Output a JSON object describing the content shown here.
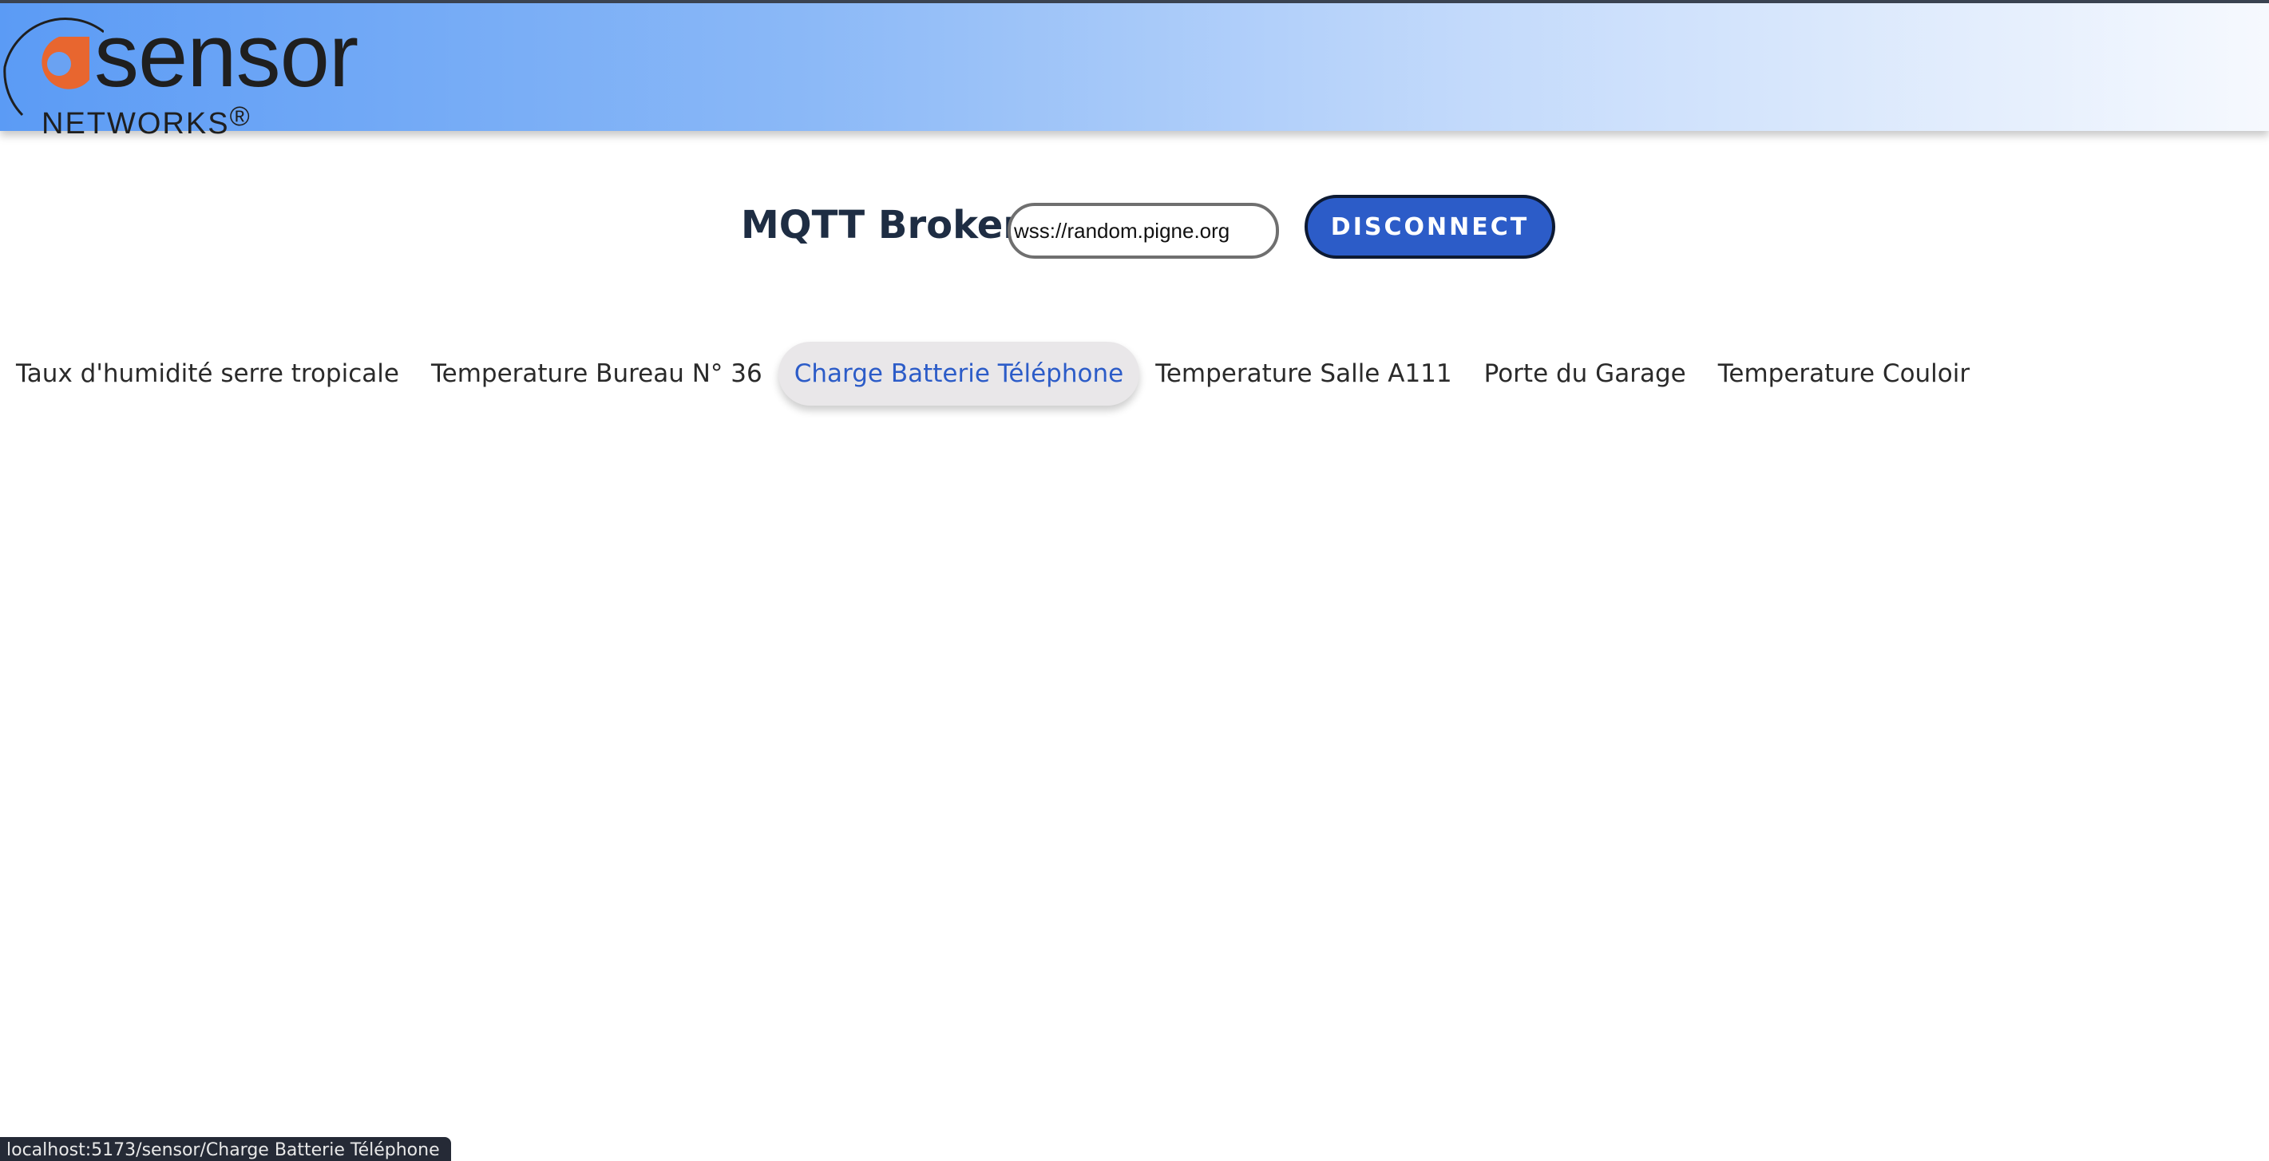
{
  "brand": {
    "wordmark": "sensor",
    "subtitle": "NETWORKS",
    "registered_mark": "®",
    "accent_color": "#e8662f",
    "header_gradient": [
      "#5b9bf5",
      "#f6f9fe"
    ]
  },
  "broker": {
    "label": "MQTT Broker:",
    "url_value": "wss://random.pigne.org",
    "disconnect_label": "DISCONNECT",
    "button_color": "#2c5cc8"
  },
  "tabs": [
    {
      "label": "Taux d'humidité serre tropicale",
      "active": false
    },
    {
      "label": "Temperature Bureau N° 36",
      "active": false
    },
    {
      "label": "Charge Batterie Téléphone",
      "active": true
    },
    {
      "label": "Temperature Salle A111",
      "active": false
    },
    {
      "label": "Porte du Garage",
      "active": false
    },
    {
      "label": "Temperature Couloir",
      "active": false
    }
  ],
  "status_bar": {
    "url": "localhost:5173/sensor/Charge Batterie Téléphone"
  }
}
